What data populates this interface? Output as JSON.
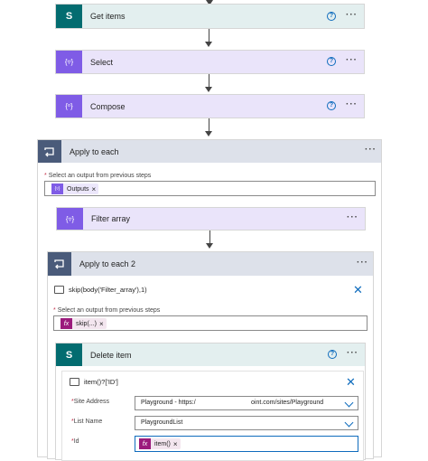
{
  "actions": {
    "get_items": {
      "title": "Get items"
    },
    "select": {
      "title": "Select"
    },
    "compose": {
      "title": "Compose"
    },
    "apply_to_each": {
      "title": "Apply to each",
      "output_label": "Select an output from previous steps",
      "token": "Outputs",
      "filter_array": {
        "title": "Filter array"
      },
      "apply_to_each_2": {
        "title": "Apply to each 2",
        "expression": "skip(body('Filter_array'),1)",
        "output_label": "Select an output from previous steps",
        "token": "skip(...)",
        "delete_item": {
          "title": "Delete item",
          "expression": "item()?['ID']",
          "site_address_label": "Site Address",
          "site_address_value": "Playground - https:/",
          "site_address_value_tail": "oint.com/sites/Playground",
          "list_name_label": "List Name",
          "list_name_value": "PlaygroundList",
          "id_label": "Id",
          "id_token": "item()"
        }
      }
    }
  },
  "glyphs": {
    "required": "*",
    "remove": "×",
    "close": "✕",
    "help": "?",
    "more": "···",
    "fx": "fx",
    "sharepoint": "S",
    "braces": "{▿}",
    "compose": "{ᵒ}"
  },
  "colors": {
    "sharepoint": "#036c70",
    "data_operation": "#7f5ce6",
    "loop": "#4a5b7a",
    "expression": "#9b1b7c",
    "link_blue": "#0f6cbd"
  }
}
